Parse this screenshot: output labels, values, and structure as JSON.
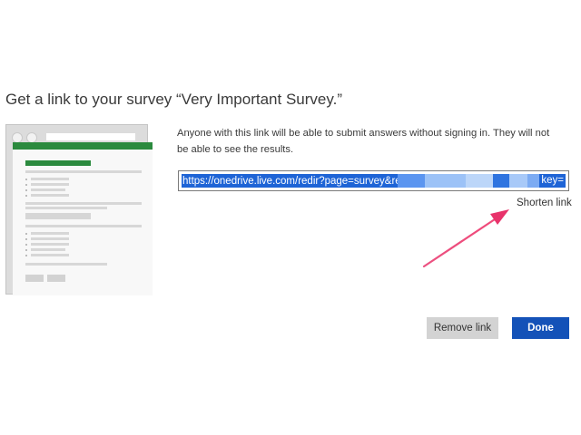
{
  "dialog": {
    "title": "Get a link to your survey “Very Important Survey.”",
    "description": "Anyone with this link will be able to submit answers without signing in. They will not be able to see the results.",
    "url_value": "https://onedrive.live.com/redir?page=survey&resid=C4",
    "url_tail": "key=",
    "shorten_link": "Shorten link",
    "remove_link_label": "Remove link",
    "done_label": "Done"
  },
  "colors": {
    "accent": "#1452b8",
    "selection": "#1e64d6",
    "annotation_arrow": "#e8336b",
    "illustration_green": "#2b8a3e"
  },
  "icons": [
    "survey-preview-illustration",
    "annotation-arrow"
  ]
}
